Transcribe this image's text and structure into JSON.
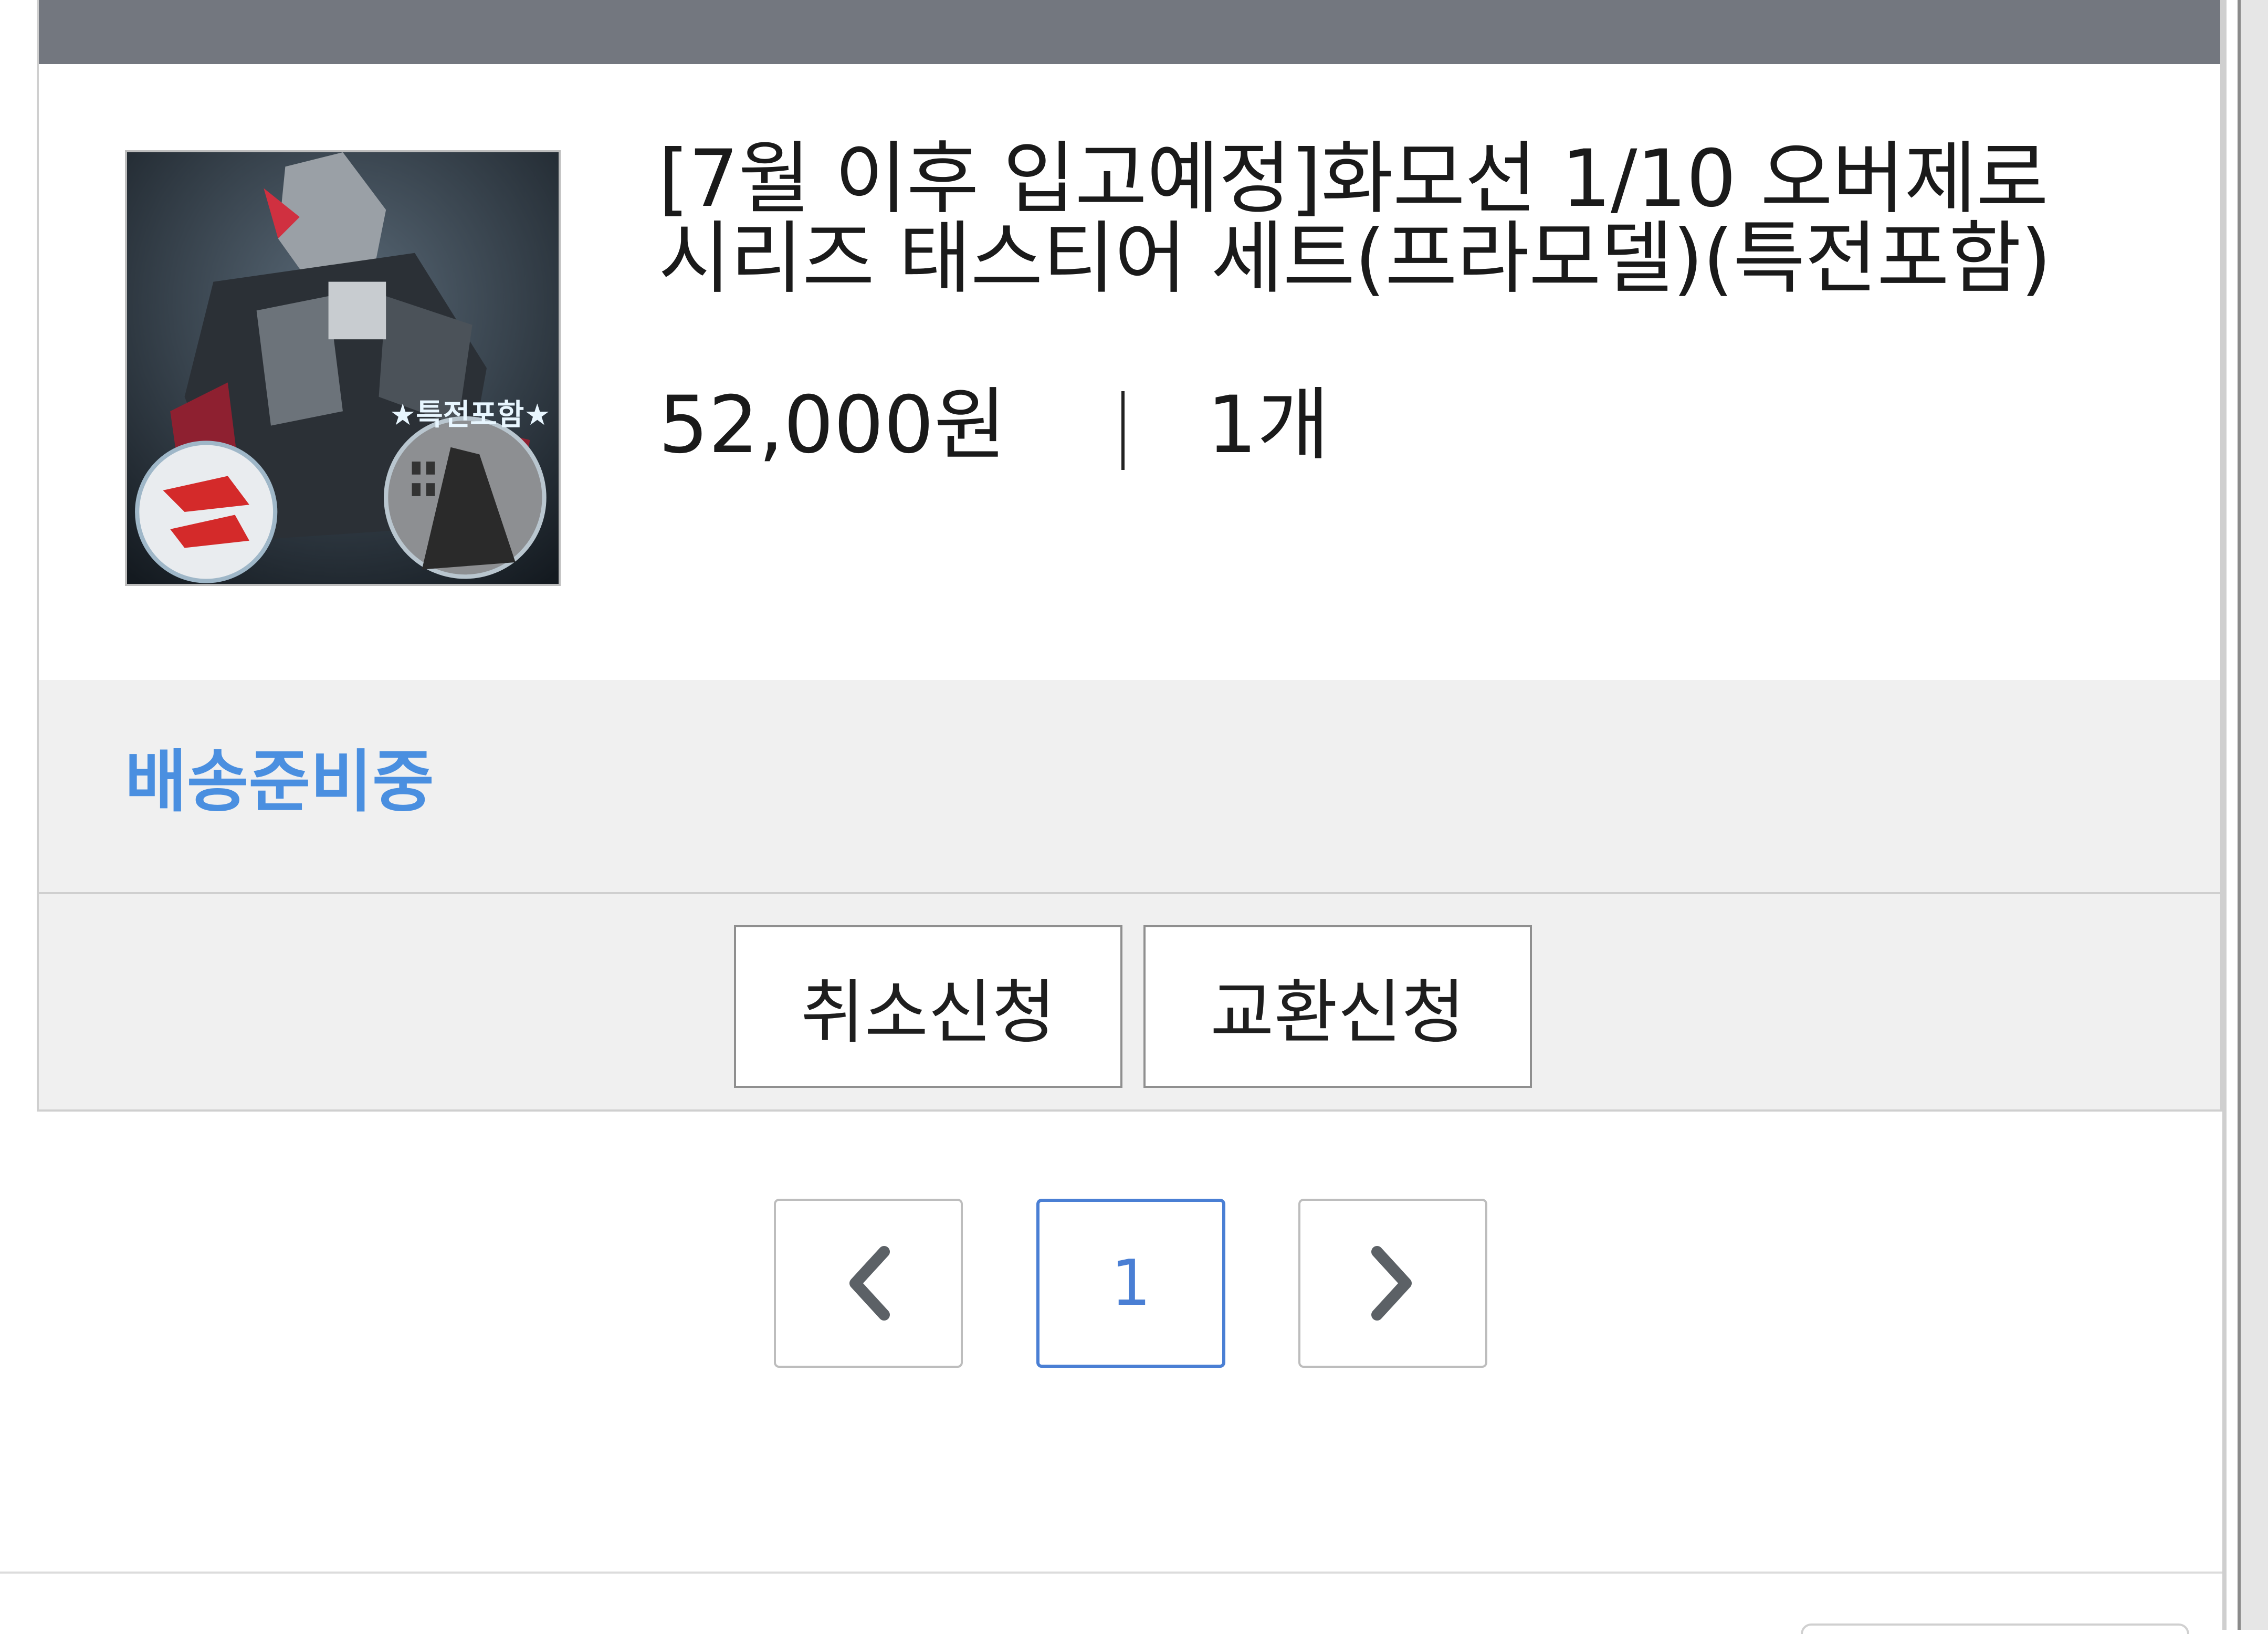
{
  "order_item": {
    "title": "[7월 이후 입고예정]화모선 1/10 오버제로 시리즈 태스티어 세트(프라모델)(특전포함)",
    "price": "52,000원",
    "quantity": "1개",
    "thumbnail_badge": "★특전포함★",
    "status": "배송준비중",
    "status_color": "#4a8fe0"
  },
  "actions": {
    "cancel_label": "취소신청",
    "exchange_label": "교환신청"
  },
  "pagination": {
    "current_page": "1",
    "prev_icon": "chevron-left-icon",
    "next_icon": "chevron-right-icon",
    "accent_color": "#4a7fd4"
  }
}
